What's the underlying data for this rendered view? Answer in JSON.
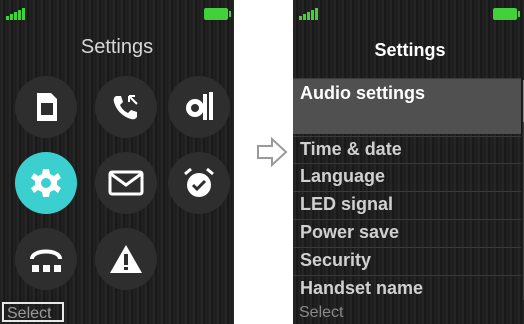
{
  "left_screen": {
    "title": "Settings",
    "softkey": "Select",
    "icons": [
      "sim-card-icon",
      "call-forward-icon",
      "device-settings-icon",
      "gear-icon",
      "envelope-icon",
      "alarm-clock-icon",
      "headset-dial-icon",
      "warning-icon"
    ],
    "selected_icon": "gear-icon"
  },
  "right_screen": {
    "title": "Settings",
    "softkey": "Select",
    "menu": [
      "Audio settings",
      "Time & date",
      "Language",
      "LED signal",
      "Power save",
      "Security",
      "Handset name"
    ],
    "selected_index": 0
  },
  "colors": {
    "accent": "#3ccfcf",
    "signal": "#43d13b",
    "battery": "#43d13b"
  }
}
